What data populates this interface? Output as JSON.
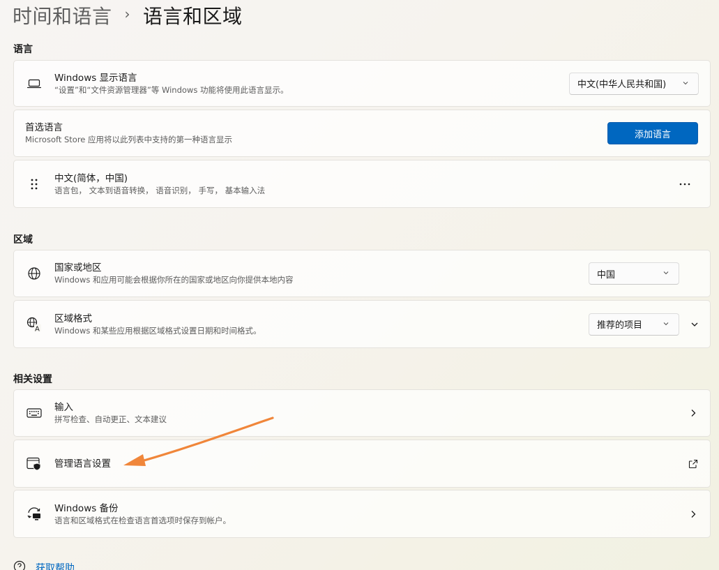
{
  "breadcrumb": {
    "parent": "时间和语言",
    "separator": "›",
    "current": "语言和区域"
  },
  "sections": {
    "language": "语言",
    "region": "区域",
    "related": "相关设置"
  },
  "display_language": {
    "title": "Windows 显示语言",
    "desc": "“设置”和“文件资源管理器”等 Windows 功能将使用此语言显示。",
    "dropdown_value": "中文(中华人民共和国)",
    "icon": "laptop-icon"
  },
  "preferred_languages": {
    "title": "首选语言",
    "desc": "Microsoft Store 应用将以此列表中支持的第一种语言显示",
    "add_button": "添加语言"
  },
  "language_item": {
    "title": "中文(简体，中国)",
    "desc": "语言包， 文本到语音转换， 语音识别， 手写， 基本输入法",
    "more": "···",
    "icon": "drag-handle-icon"
  },
  "country": {
    "title": "国家或地区",
    "desc": "Windows 和应用可能会根据你所在的国家或地区向你提供本地内容",
    "dropdown_value": "中国",
    "icon": "globe-icon"
  },
  "regional_format": {
    "title": "区域格式",
    "desc": "Windows 和某些应用根据区域格式设置日期和时间格式。",
    "dropdown_value": "推荐的项目",
    "icon": "globe-language-icon"
  },
  "typing": {
    "title": "输入",
    "desc": "拼写检查、自动更正、文本建议",
    "icon": "keyboard-icon"
  },
  "admin_language": {
    "title": "管理语言设置",
    "icon": "admin-shield-icon"
  },
  "backup": {
    "title": "Windows 备份",
    "desc": "语言和区域格式在检查语言首选项时保存到帐户。",
    "icon": "sync-backup-icon"
  },
  "help": {
    "label": "获取帮助"
  },
  "colors": {
    "accent": "#0067c0",
    "annotation_arrow": "#f0863a"
  }
}
